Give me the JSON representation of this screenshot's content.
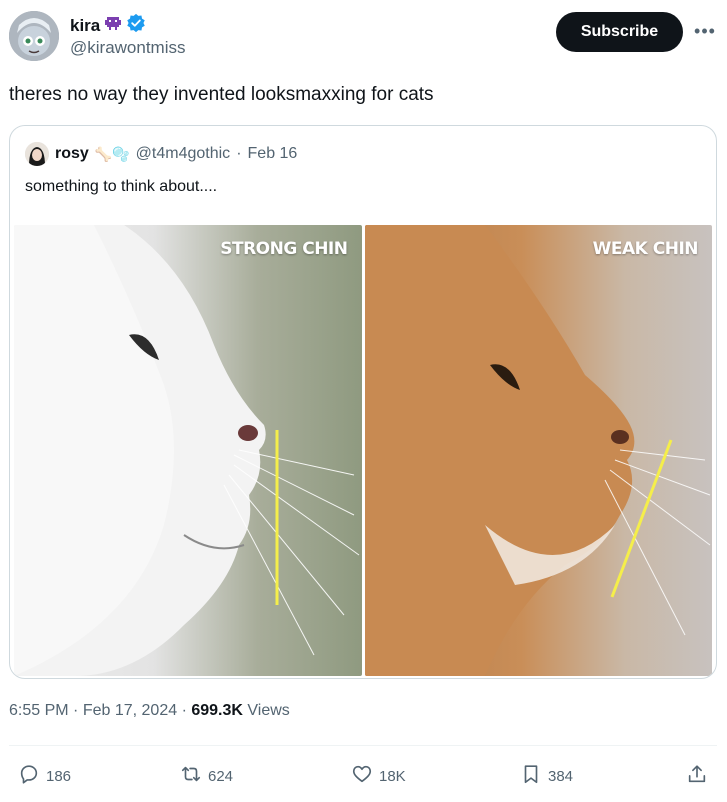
{
  "author": {
    "name": "kira",
    "handle": "@kirawontmiss",
    "badges": [
      "alien-monster-emoji",
      "verified-badge-icon"
    ]
  },
  "subscribe_label": "Subscribe",
  "tweet_text": "theres no way they invented looksmaxxing for cats",
  "quote": {
    "name": "rosy",
    "emojis": "🦴🫧",
    "handle": "@t4m4gothic",
    "separator": "·",
    "date": "Feb 16",
    "text": "something to think about....",
    "images": [
      {
        "label": "STRONG CHIN"
      },
      {
        "label": "WEAK CHIN"
      }
    ]
  },
  "meta": {
    "time": "6:55 PM",
    "sep1": "·",
    "date": "Feb 17, 2024",
    "sep2": "·",
    "views_count": "699.3K",
    "views_label": "Views"
  },
  "actions": {
    "replies": "186",
    "reposts": "624",
    "likes": "18K",
    "bookmarks": "384"
  },
  "colors": {
    "text": "#0f1419",
    "secondary": "#536471",
    "verified": "#1d9bf0",
    "chin_line": "#f5ee4a"
  }
}
